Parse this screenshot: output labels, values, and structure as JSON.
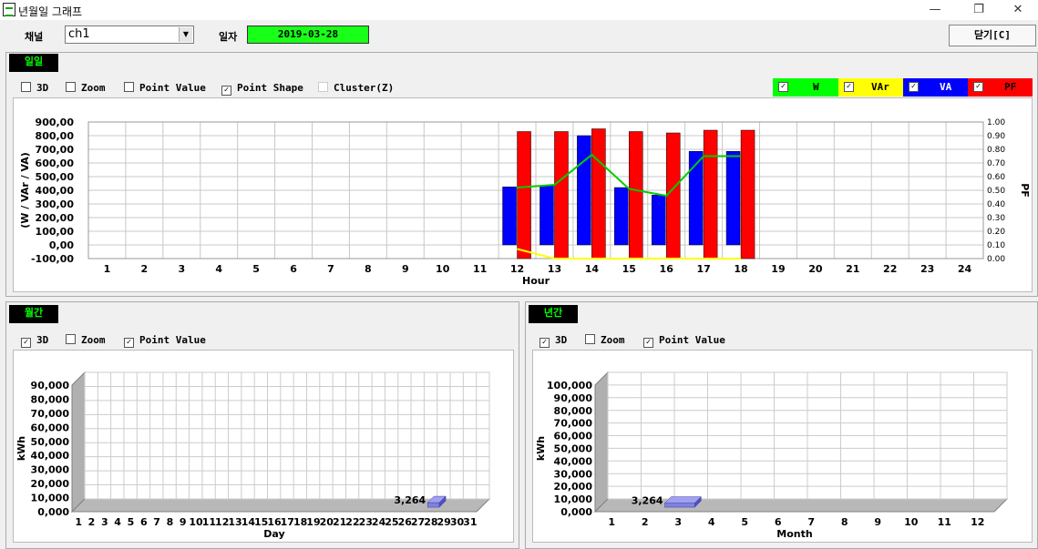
{
  "window": {
    "title": "년월일 그래프",
    "minimize": "—",
    "restore": "❐",
    "close": "✕"
  },
  "toolbar": {
    "channel_label": "채널",
    "channel_value": "ch1",
    "date_label": "일자",
    "date_value": "2019-03-28",
    "close_button": "닫기[C]"
  },
  "daily": {
    "tab": "일일",
    "options": [
      {
        "label": "3D",
        "checked": false
      },
      {
        "label": "Zoom",
        "checked": false
      },
      {
        "label": "Point Value",
        "checked": false
      },
      {
        "label": "Point Shape",
        "checked": true
      },
      {
        "label": "Cluster(Z)",
        "checked": false
      }
    ],
    "legend": [
      {
        "label": "W",
        "color": "#00ff00",
        "checked": true
      },
      {
        "label": "VAr",
        "color": "#ffff00",
        "checked": true
      },
      {
        "label": "VA",
        "color": "#0000ff",
        "checked": true
      },
      {
        "label": "PF",
        "color": "#ff0000",
        "checked": true
      }
    ]
  },
  "monthly": {
    "tab": "월간",
    "options": [
      {
        "label": "3D",
        "checked": true
      },
      {
        "label": "Zoom",
        "checked": false
      },
      {
        "label": "Point Value",
        "checked": true
      }
    ]
  },
  "yearly": {
    "tab": "년간",
    "options": [
      {
        "label": "3D",
        "checked": true
      },
      {
        "label": "Zoom",
        "checked": false
      },
      {
        "label": "Point Value",
        "checked": true
      }
    ]
  },
  "chart_data": [
    {
      "type": "bar",
      "xlabel": "Hour",
      "ylabel": "(W / VAr / VA)",
      "y2label": "PF",
      "ylim": [
        -100,
        900
      ],
      "y2lim": [
        0,
        1
      ],
      "yticks": [
        "900,00",
        "800,00",
        "700,00",
        "600,00",
        "500,00",
        "400,00",
        "300,00",
        "200,00",
        "100,00",
        "0,00",
        "-100,00"
      ],
      "y2ticks": [
        "1.00",
        "0.90",
        "0.80",
        "0.70",
        "0.60",
        "0.50",
        "0.40",
        "0.30",
        "0.20",
        "0.10",
        "0.00"
      ],
      "categories": [
        "1",
        "2",
        "3",
        "4",
        "5",
        "6",
        "7",
        "8",
        "9",
        "10",
        "11",
        "12",
        "13",
        "14",
        "15",
        "16",
        "17",
        "18",
        "19",
        "20",
        "21",
        "22",
        "23",
        "24"
      ],
      "series": [
        {
          "name": "W",
          "kind": "line",
          "color": "#00cc00",
          "x": [
            12,
            13,
            14,
            15,
            16,
            17,
            18
          ],
          "values": [
            420,
            440,
            660,
            410,
            360,
            650,
            650
          ]
        },
        {
          "name": "VAr",
          "kind": "line",
          "color": "#ffff00",
          "x": [
            12,
            13,
            14,
            15,
            16,
            17,
            18
          ],
          "values": [
            -30,
            -100,
            -100,
            -100,
            -100,
            -100,
            -100
          ]
        },
        {
          "name": "VA",
          "kind": "bar",
          "color": "#0000ff",
          "x": [
            12,
            13,
            14,
            15,
            16,
            17,
            18
          ],
          "values": [
            425,
            435,
            800,
            420,
            365,
            685,
            685
          ]
        },
        {
          "name": "PF",
          "kind": "bar",
          "axis": "y2",
          "color": "#ff0000",
          "x": [
            12,
            13,
            14,
            15,
            16,
            17,
            18
          ],
          "values": [
            0.93,
            0.93,
            0.95,
            0.93,
            0.92,
            0.94,
            0.94
          ]
        }
      ],
      "grid": true
    },
    {
      "type": "bar",
      "xlabel": "Day",
      "ylabel": "kWh",
      "ylim": [
        0,
        90000
      ],
      "yticks": [
        "90,000",
        "80,000",
        "70,000",
        "60,000",
        "50,000",
        "40,000",
        "30,000",
        "20,000",
        "10,000",
        "0,000"
      ],
      "categories": [
        "1",
        "2",
        "3",
        "4",
        "5",
        "6",
        "7",
        "8",
        "9",
        "10",
        "11",
        "12",
        "13",
        "14",
        "15",
        "16",
        "17",
        "18",
        "19",
        "20",
        "21",
        "22",
        "23",
        "24",
        "25",
        "26",
        "27",
        "28",
        "29",
        "30",
        "31"
      ],
      "series": [
        {
          "x": [
            "28"
          ],
          "values": [
            3264
          ],
          "labels": [
            "3,264"
          ],
          "color": "#8080e0"
        }
      ],
      "grid": true,
      "three_d": true
    },
    {
      "type": "bar",
      "xlabel": "Month",
      "ylabel": "kWh",
      "ylim": [
        0,
        100000
      ],
      "yticks": [
        "100,000",
        "90,000",
        "80,000",
        "70,000",
        "60,000",
        "50,000",
        "40,000",
        "30,000",
        "20,000",
        "10,000",
        "0,000"
      ],
      "categories": [
        "1",
        "2",
        "3",
        "4",
        "5",
        "6",
        "7",
        "8",
        "9",
        "10",
        "11",
        "12"
      ],
      "series": [
        {
          "x": [
            "3"
          ],
          "values": [
            3264
          ],
          "labels": [
            "3,264"
          ],
          "color": "#8080e0"
        }
      ],
      "grid": true,
      "three_d": true
    }
  ]
}
